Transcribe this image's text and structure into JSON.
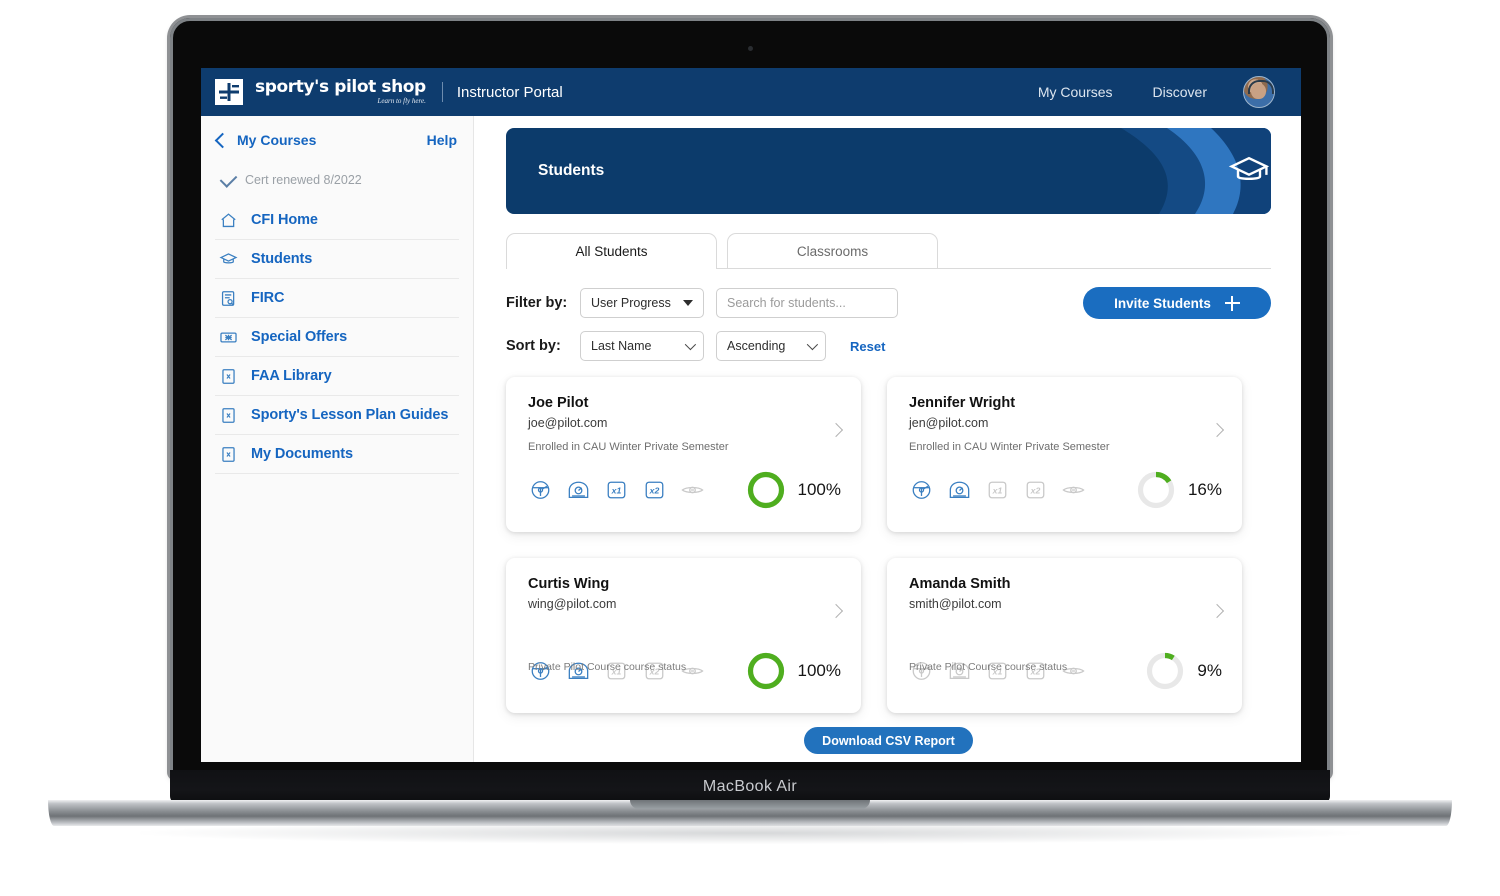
{
  "device": {
    "label": "MacBook Air"
  },
  "topbar": {
    "brand_line1": "sporty's pilot shop",
    "brand_line2": "Learn to fly here.",
    "portal_title": "Instructor Portal",
    "nav": [
      {
        "label": "My Courses",
        "name": "nav-my-courses"
      },
      {
        "label": "Discover",
        "name": "nav-discover"
      }
    ],
    "avatar_name": "user-avatar"
  },
  "sidebar": {
    "back_label": "My Courses",
    "help_label": "Help",
    "cert_status": "Cert renewed 8/2022",
    "items": [
      {
        "label": "CFI Home",
        "icon": "home-icon"
      },
      {
        "label": "Students",
        "icon": "graduation-cap-icon"
      },
      {
        "label": "FIRC",
        "icon": "clipboard-search-icon"
      },
      {
        "label": "Special Offers",
        "icon": "ticket-icon"
      },
      {
        "label": "FAA Library",
        "icon": "pdf-file-icon"
      },
      {
        "label": "Sporty's Lesson Plan Guides",
        "icon": "pdf-file-icon"
      },
      {
        "label": "My Documents",
        "icon": "pdf-file-icon"
      }
    ]
  },
  "banner": {
    "title": "Students",
    "icon": "graduation-cap-icon",
    "bg_color": "#0c3b6b"
  },
  "tabs": [
    {
      "label": "All Students",
      "active": true
    },
    {
      "label": "Classrooms",
      "active": false
    }
  ],
  "filters": {
    "filter_by_label": "Filter by:",
    "filter_value": "User Progress",
    "search_placeholder": "Search for students...",
    "search_value": "",
    "invite_label": "Invite Students",
    "sort_by_label": "Sort by:",
    "sort_field_value": "Last Name",
    "sort_dir_value": "Ascending",
    "reset_label": "Reset"
  },
  "students": [
    {
      "name": "Joe Pilot",
      "email": "joe@pilot.com",
      "enrollment": "Enrolled in CAU Winter Private Semester",
      "status_note": "",
      "progress": 100,
      "progress_label": "100%",
      "badges": [
        {
          "name": "yoke-badge",
          "earned": true
        },
        {
          "name": "gauge-badge",
          "earned": true
        },
        {
          "name": "x1-badge",
          "earned": true
        },
        {
          "name": "x2-badge",
          "earned": true
        },
        {
          "name": "wings-badge",
          "earned": false
        }
      ]
    },
    {
      "name": "Jennifer Wright",
      "email": "jen@pilot.com",
      "enrollment": "Enrolled in CAU Winter Private Semester",
      "status_note": "",
      "progress": 16,
      "progress_label": "16%",
      "badges": [
        {
          "name": "yoke-badge",
          "earned": true
        },
        {
          "name": "gauge-badge",
          "earned": true
        },
        {
          "name": "x1-badge",
          "earned": false
        },
        {
          "name": "x2-badge",
          "earned": false
        },
        {
          "name": "wings-badge",
          "earned": false
        }
      ]
    },
    {
      "name": "Curtis Wing",
      "email": "wing@pilot.com",
      "enrollment": "",
      "status_note": "Private Pilot Course course status",
      "progress": 100,
      "progress_label": "100%",
      "badges": [
        {
          "name": "yoke-badge",
          "earned": true
        },
        {
          "name": "gauge-badge",
          "earned": true
        },
        {
          "name": "x1-badge",
          "earned": false
        },
        {
          "name": "x2-badge",
          "earned": false
        },
        {
          "name": "wings-badge",
          "earned": false
        }
      ]
    },
    {
      "name": "Amanda Smith",
      "email": "smith@pilot.com",
      "enrollment": "",
      "status_note": "Private Pilot Course course status",
      "progress": 9,
      "progress_label": "9%",
      "badges": [
        {
          "name": "yoke-badge",
          "earned": false
        },
        {
          "name": "gauge-badge",
          "earned": false
        },
        {
          "name": "x1-badge",
          "earned": false
        },
        {
          "name": "x2-badge",
          "earned": false
        },
        {
          "name": "wings-badge",
          "earned": false
        }
      ]
    }
  ],
  "footer": {
    "csv_label": "Download CSV Report"
  },
  "colors": {
    "brand_navy": "#0e3c6e",
    "link_blue": "#1565c0",
    "button_blue": "#1a6dc0",
    "progress_green": "#4fae1f",
    "track_grey": "#e8e8e8",
    "badge_blue": "#3a7fc1",
    "badge_grey": "#c9c9c9"
  }
}
